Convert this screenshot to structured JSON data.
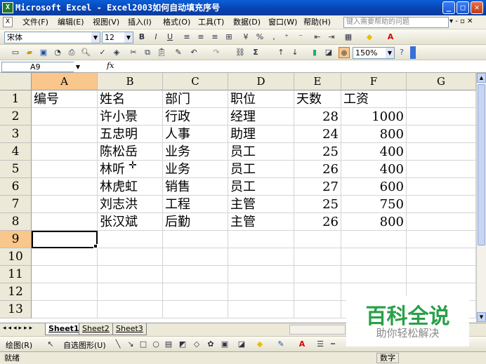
{
  "window": {
    "title": "Microsoft Excel - Excel2003如何自动填充序号",
    "icon": "excel-icon"
  },
  "menu": {
    "items": [
      "文件(F)",
      "编辑(E)",
      "视图(V)",
      "插入(I)",
      "格式(O)",
      "工具(T)",
      "数据(D)",
      "窗口(W)",
      "帮助(H)"
    ],
    "help_placeholder": "键入需要帮助的问题"
  },
  "format_toolbar": {
    "font": "宋体",
    "size": "12"
  },
  "standard_toolbar": {
    "zoom": "150%"
  },
  "formula_bar": {
    "name_box": "A9",
    "fx": "fx",
    "value": ""
  },
  "sheet": {
    "columns": [
      "A",
      "B",
      "C",
      "D",
      "E",
      "F",
      "G"
    ],
    "selected_column": "A",
    "row_numbers": [
      "1",
      "2",
      "3",
      "4",
      "5",
      "6",
      "7",
      "8",
      "9",
      "10",
      "11",
      "12",
      "13"
    ],
    "selected_row": "9",
    "rows": [
      [
        "编号",
        "姓名",
        "部门",
        "职位",
        "天数",
        "工资",
        ""
      ],
      [
        "",
        "许小景",
        "行政",
        "经理",
        "28",
        "1000",
        ""
      ],
      [
        "",
        "五忠明",
        "人事",
        "助理",
        "24",
        "800",
        ""
      ],
      [
        "",
        "陈松岳",
        "业务",
        "员工",
        "25",
        "400",
        ""
      ],
      [
        "",
        "林听",
        "业务",
        "员工",
        "26",
        "400",
        ""
      ],
      [
        "",
        "林虎虹",
        "销售",
        "员工",
        "27",
        "600",
        ""
      ],
      [
        "",
        "刘志洪",
        "工程",
        "主管",
        "25",
        "750",
        ""
      ],
      [
        "",
        "张汉斌",
        "后勤",
        "主管",
        "26",
        "800",
        ""
      ]
    ]
  },
  "tabs": {
    "items": [
      "Sheet1",
      "Sheet2",
      "Sheet3"
    ],
    "active": "Sheet1"
  },
  "draw_toolbar": {
    "draw_label": "绘图(R)",
    "autoshape_label": "自选图形(U)"
  },
  "status": {
    "left": "就绪",
    "right": "数字"
  },
  "watermark": {
    "title": "百科全说",
    "subtitle": "助你轻松解决"
  }
}
